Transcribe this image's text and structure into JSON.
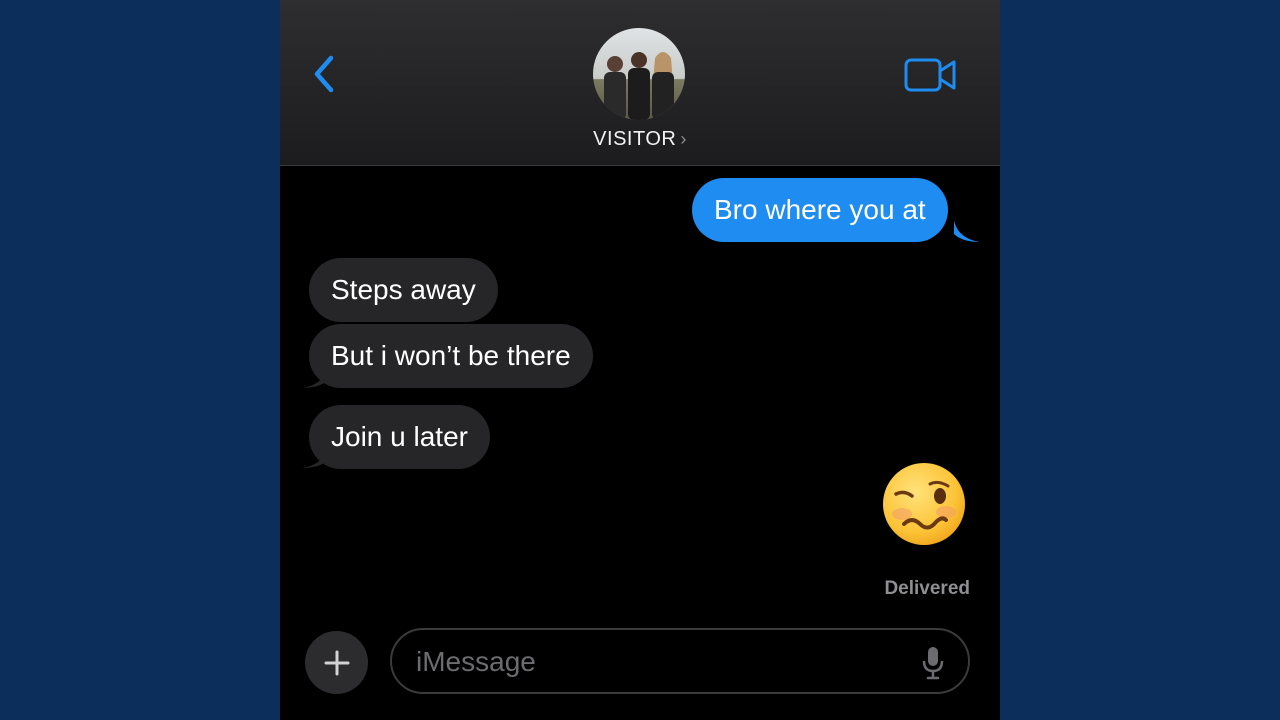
{
  "header": {
    "contact_name": "VISITOR",
    "chevron": "›",
    "back_icon": "chevron-left-icon",
    "video_icon": "video-camera-icon",
    "accent_color": "#1e8cf0"
  },
  "messages": [
    {
      "direction": "outgoing",
      "text": "Bro where you at"
    },
    {
      "direction": "incoming",
      "text": "Steps away"
    },
    {
      "direction": "incoming",
      "text": "But i won’t be there"
    },
    {
      "direction": "incoming",
      "text": "Join u later"
    },
    {
      "direction": "outgoing",
      "emoji": "woozy-face"
    }
  ],
  "status": {
    "delivered": "Delivered"
  },
  "composer": {
    "placeholder": "iMessage",
    "value": "",
    "add_icon": "plus-icon",
    "mic_icon": "microphone-icon"
  }
}
